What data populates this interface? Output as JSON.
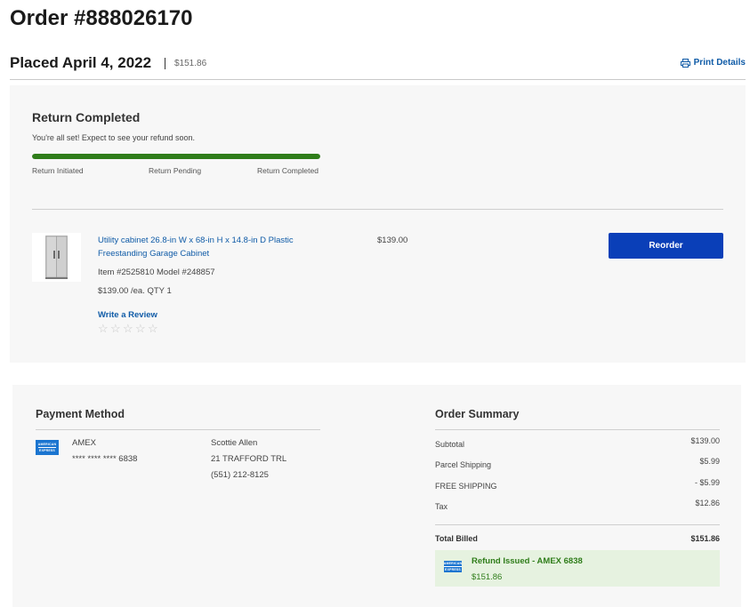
{
  "header": {
    "order_title": "Order #888026170",
    "placed_label": "Placed April 4, 2022",
    "order_total": "$151.86",
    "print_label": "Print Details"
  },
  "return_status": {
    "title": "Return Completed",
    "subtitle": "You're all set! Expect to see your refund soon.",
    "progress": 1.0,
    "progress_color": "#2f7d1a",
    "steps": [
      "Return Initiated",
      "Return Pending",
      "Return Completed"
    ]
  },
  "item": {
    "name": "Utility cabinet 26.8-in W x 68-in H x 14.8-in D Plastic Freestanding Garage Cabinet",
    "item_model": "Item #2525810 Model #248857",
    "price_each_qty": "$139.00 /ea. QTY 1",
    "price": "$139.00",
    "write_review_label": "Write a Review",
    "rating_stars": 0,
    "max_stars": 5,
    "reorder_label": "Reorder",
    "reorder_color": "#0a3fb8",
    "image_icon": "storage-cabinet-image"
  },
  "payment_method": {
    "title": "Payment Method",
    "card_type": "AMEX",
    "card_number": "**** **** **** 6838",
    "card_logo_text": [
      "AMERICAN",
      "EXPRESS"
    ],
    "billing_name": "Scottie Allen",
    "billing_street": "21 TRAFFORD TRL",
    "billing_phone": "(551) 212-8125"
  },
  "order_summary": {
    "title": "Order Summary",
    "rows": [
      {
        "label": "Subtotal",
        "value": "$139.00"
      },
      {
        "label": "Parcel Shipping",
        "value": "$5.99"
      },
      {
        "label": "FREE SHIPPING",
        "value": "- $5.99"
      },
      {
        "label": "Tax",
        "value": "$12.86"
      }
    ],
    "total_label": "Total Billed",
    "total_value": "$151.86",
    "refund_label": "Refund Issued - AMEX 6838",
    "refund_amount": "$151.86",
    "refund_color": "#2f7d1a"
  }
}
